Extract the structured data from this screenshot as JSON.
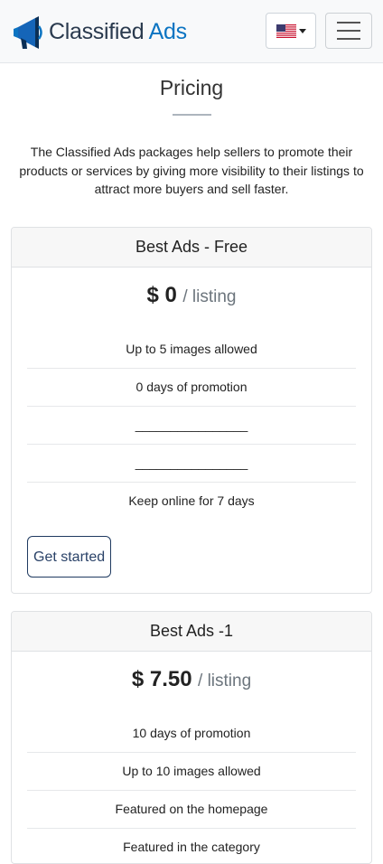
{
  "header": {
    "logo_word1": "Classified",
    "logo_word2": "Ads",
    "language_flag": "us-flag-icon",
    "menu_icon": "hamburger-icon"
  },
  "page": {
    "title": "Pricing",
    "intro": "The Classified Ads packages help sellers to promote their products or services by giving more visibility to their listings to attract more buyers and sell faster."
  },
  "packages": [
    {
      "name": "Best Ads - Free",
      "price": "$ 0",
      "unit": "/ listing",
      "features": [
        "Up to 5 images allowed",
        "0 days of promotion",
        "________________",
        "________________",
        "Keep online for 7 days"
      ],
      "button": "Get started"
    },
    {
      "name": "Best Ads -1",
      "price": "$ 7.50",
      "unit": "/ listing",
      "features": [
        "10 days of promotion",
        "Up to 10 images allowed",
        "Featured on the homepage",
        "Featured in the category"
      ]
    }
  ],
  "colors": {
    "brand_dark": "#2a3a4e",
    "brand_blue": "#0b74c2",
    "button_border": "#1f3a60"
  }
}
